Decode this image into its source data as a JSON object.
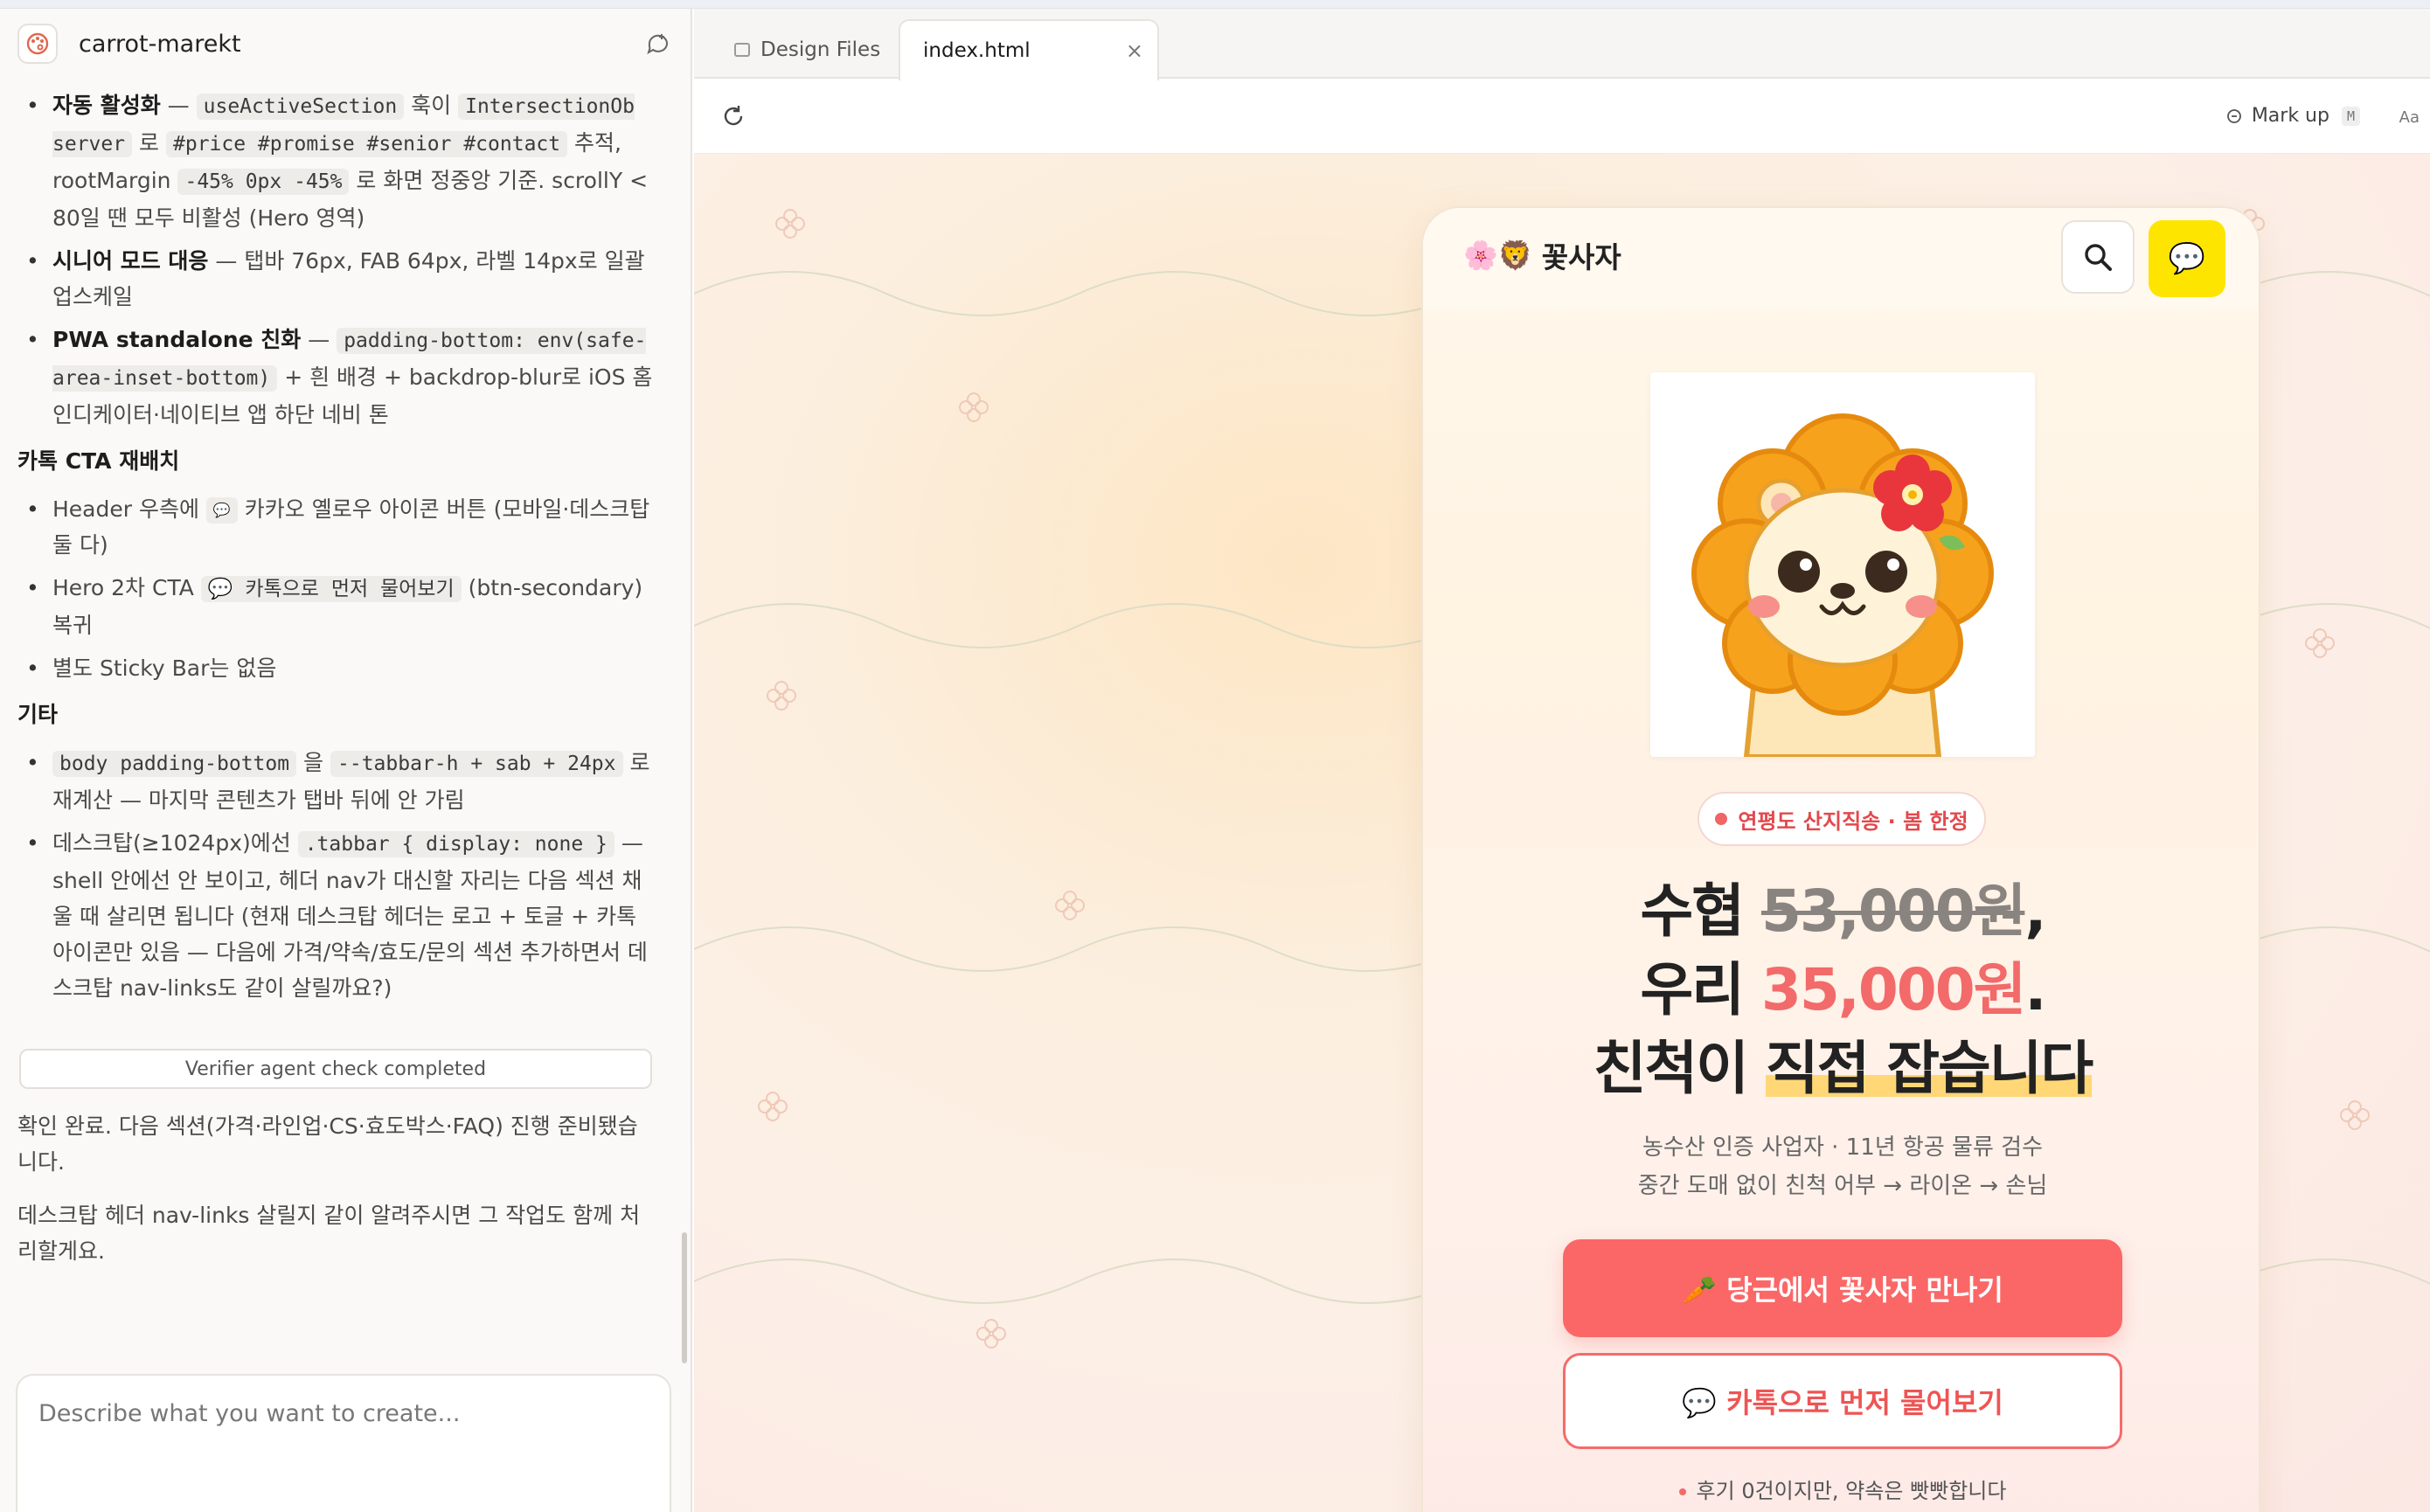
{
  "app": {
    "project_name": "carrot-marekt"
  },
  "chat": {
    "item1": {
      "bold": "자동 활성화",
      "t1": " — ",
      "c1": "useActiveSection",
      "t2": " 훅이 ",
      "c2": "IntersectionOb server",
      "t3": " 로 ",
      "c3": "#price #promise #senior #contact",
      "t4": " 추적, rootMargin ",
      "c4": "-45% 0px -45%",
      "t5": " 로 화면 정중앙 기준. scrollY < 80일 땐 모두 비활성 (Hero 영역)"
    },
    "item2": {
      "bold": "시니어 모드 대응",
      "rest": " — 탭바 76px, FAB 64px, 라벨 14px로 일괄 업스케일"
    },
    "item3": {
      "bold": "PWA standalone 친화",
      "t1": " — ",
      "c1": "padding-bottom: env(safe-area-inset-bottom)",
      "t2": " + 흰 배경 + backdrop-blur로 iOS 홈 인디케이터·네이티브 앱 하단 네비 톤"
    },
    "section_kakao": "카톡 CTA 재배치",
    "kakao1": {
      "t1": "Header 우측에 ",
      "bubble": "💬",
      "t2": " 카카오 옐로우 아이콘 버튼 (모바일·데스크탑 둘 다)"
    },
    "kakao2": {
      "t1": "Hero 2차 CTA ",
      "code": "💬 카톡으로 먼저 물어보기",
      "t2": " (btn-secondary) 복귀"
    },
    "kakao3": "별도 Sticky Bar는 없음",
    "section_etc": "기타",
    "etc1": {
      "c1": "body padding-bottom",
      "t1": " 을 ",
      "c2": "--tabbar-h + sab + 24px",
      "t2": " 로 재계산 — 마지막 콘텐츠가 탭바 뒤에 안 가림"
    },
    "etc2": {
      "t1": "데스크탑(≥1024px)에선 ",
      "c1": ".tabbar { display: none }",
      "t2": " — shell 안에선 안 보이고, 헤더 nav가 대신할 자리는 다음 섹션 채울 때 살리면 됩니다 (현재 데스크탑 헤더는 로고 + 토글 + 카톡 아이콘만 있음 — 다음에 가격/약속/효도/문의 섹션 추가하면서 데스크탑 nav-links도 같이 살릴까요?)"
    },
    "verifier": "Verifier agent check completed",
    "msg1": "확인 완료. 다음 섹션(가격·라인업·CS·효도박스·FAQ) 진행 준비됐습니다.",
    "msg2": "데스크탑 헤더 nav-links 살릴지 같이 알려주시면 그 작업도 함께 처리할게요.",
    "composer_placeholder": "Describe what you want to create..."
  },
  "tabs": [
    {
      "label": "Design Files"
    },
    {
      "label": "index.html",
      "close": "×"
    }
  ],
  "toolbar": {
    "markup_label": "Mark up",
    "markup_key": "M",
    "aa": "Aa"
  },
  "site": {
    "brand_emoji": "🌸🦁",
    "brand_name": "꽃사자",
    "kakao_icon": "💬",
    "badge": "연평도 산지직송 · 봄 한정",
    "h1_a": "수협 ",
    "h1_strike": "53,000원",
    "h1_b": ",",
    "h2_a": "우리 ",
    "h2_price": "35,000원",
    "h2_b": ".",
    "h3_a": "친척이 ",
    "h3_hl": "직접 잡습니다",
    "sub1": "농수산 인증 사업자 · 11년 항공 물류 검수",
    "sub2": "중간 도매 없이 친척 어부 → 라이온 → 손님",
    "cta_primary": "🥕 당근에서 꽃사자 만나기",
    "cta_secondary": "💬 카톡으로 먼저 물어보기",
    "review_note": "후기 0건이지만, 약속은 빳빳합니다"
  },
  "colors": {
    "accent": "#fb6767",
    "kakao": "#fee500",
    "badge_text": "#e2494d",
    "highlight": "#ffd776"
  }
}
